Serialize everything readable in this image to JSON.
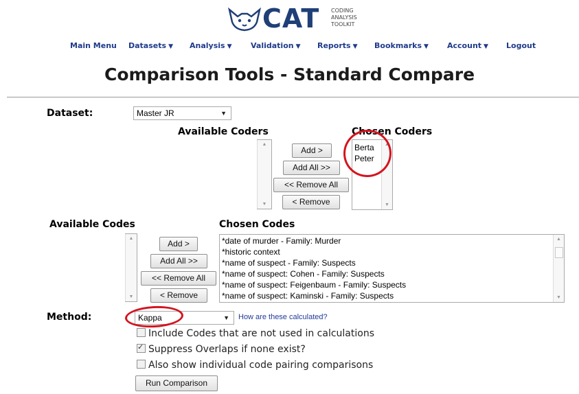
{
  "logo": {
    "name": "CAT",
    "line1": "CODING",
    "line2": "ANALYSIS",
    "line3": "TOOLKIT"
  },
  "nav": {
    "main_menu": "Main Menu",
    "datasets": "Datasets",
    "analysis": "Analysis",
    "validation": "Validation",
    "reports": "Reports",
    "bookmarks": "Bookmarks",
    "account": "Account",
    "logout": "Logout",
    "caret": "▼"
  },
  "page_title": "Comparison Tools - Standard Compare",
  "dataset": {
    "label": "Dataset:",
    "value": "Master JR"
  },
  "coders": {
    "available_label": "Available Coders",
    "chosen_label": "Chosen Coders",
    "available": [],
    "chosen": [
      "Berta",
      "Peter"
    ],
    "add": "Add >",
    "add_all": "Add All >>",
    "remove_all": "<< Remove All",
    "remove": "< Remove"
  },
  "codes": {
    "available_label": "Available Codes",
    "chosen_label": "Chosen Codes",
    "available": [],
    "chosen": [
      "*date of murder - Family: Murder",
      "*historic context",
      "*name of suspect - Family: Suspects",
      "*name of suspect: Cohen - Family: Suspects",
      "*name of suspect: Feigenbaum - Family: Suspects",
      "*name of suspect: Kaminski - Family: Suspects"
    ],
    "add": "Add >",
    "add_all": "Add All >>",
    "remove_all": "<< Remove All",
    "remove": "< Remove"
  },
  "method": {
    "label": "Method:",
    "value": "Kappa",
    "help_link": "How are these calculated?"
  },
  "options": [
    {
      "label": "Include Codes that are not used in calculations",
      "checked": false
    },
    {
      "label": "Suppress Overlaps if none exist?",
      "checked": true
    },
    {
      "label": "Also show individual code pairing comparisons",
      "checked": false
    }
  ],
  "run_button": "Run Comparison",
  "colors": {
    "nav": "#1f3a8a",
    "logo": "#1f3f77",
    "highlight_ring": "#d4141f"
  }
}
